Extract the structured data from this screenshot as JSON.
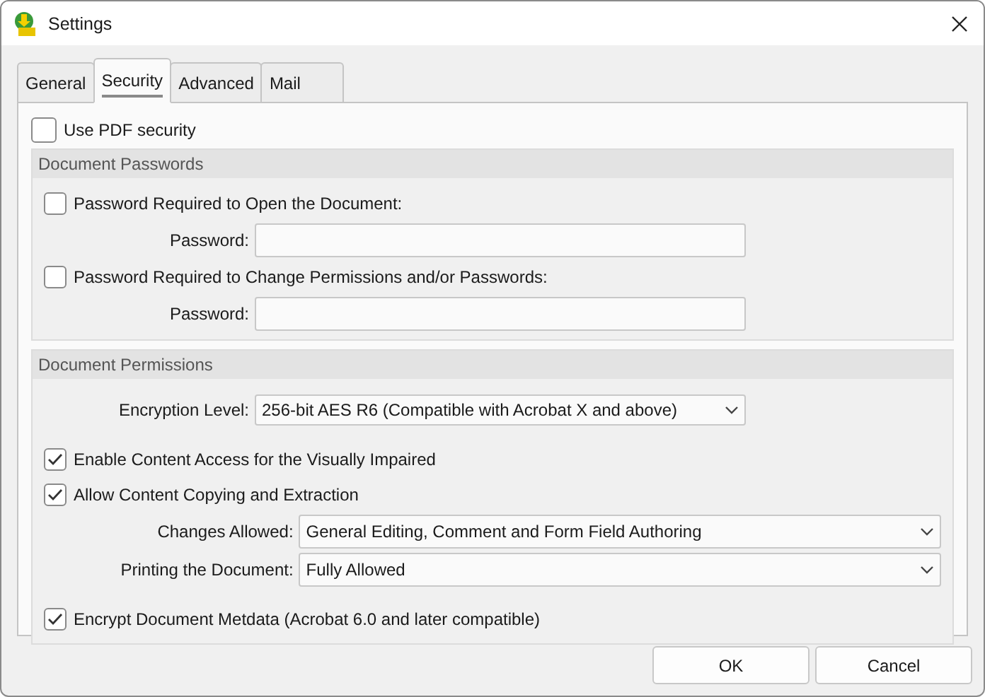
{
  "window": {
    "title": "Settings"
  },
  "tabs": [
    {
      "label": "General",
      "selected": false
    },
    {
      "label": "Security",
      "selected": true
    },
    {
      "label": "Advanced",
      "selected": false
    },
    {
      "label": "Mail",
      "selected": false
    }
  ],
  "use_pdf_security": {
    "label": "Use PDF security",
    "checked": false
  },
  "document_passwords": {
    "title": "Document Passwords",
    "items": [
      {
        "label": "Password Required to Open the Document:",
        "checked": false,
        "field_label": "Password:"
      },
      {
        "label": "Password Required to Change Permissions and/or Passwords:",
        "checked": false,
        "field_label": "Password:"
      }
    ]
  },
  "document_permissions": {
    "title": "Document Permissions",
    "rows": [
      {
        "kind": "select",
        "label": "Encryption Level:",
        "value": "256-bit AES R6 (Compatible with Acrobat X and above)"
      },
      {
        "kind": "checkbox",
        "label": "Enable Content Access for the Visually Impaired",
        "checked": true
      },
      {
        "kind": "checkbox",
        "label": "Allow Content Copying and Extraction",
        "checked": true
      },
      {
        "kind": "select",
        "label": "Changes Allowed:",
        "value": "General Editing, Comment and Form Field Authoring"
      },
      {
        "kind": "select",
        "label": "Printing the Document:",
        "value": "Fully Allowed"
      },
      {
        "kind": "checkbox",
        "label": "Encrypt Document Metdata (Acrobat 6.0 and later compatible)",
        "checked": true
      }
    ]
  },
  "buttons": [
    {
      "label": "OK"
    },
    {
      "label": "Cancel"
    }
  ]
}
